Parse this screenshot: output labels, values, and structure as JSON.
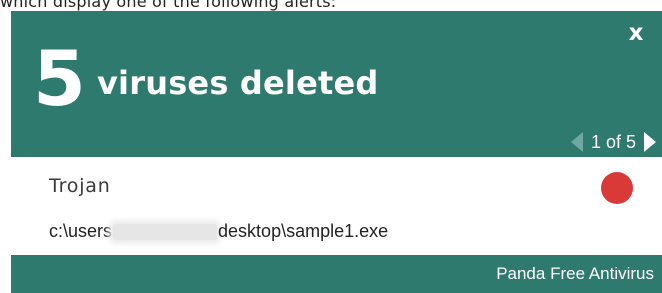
{
  "background_text": "which display one of the following alerts:",
  "notification": {
    "close_label": "x",
    "count": "5",
    "title": "viruses deleted",
    "pager": {
      "current": 1,
      "total": 5,
      "text": "1 of 5"
    },
    "threat": {
      "name": "Trojan",
      "severity_color": "#d93a38",
      "path_prefix": "c:\\users",
      "path_suffix": "desktop\\sample1.exe"
    },
    "brand": "Panda Free Antivirus"
  },
  "colors": {
    "accent": "#2e7a6e",
    "text_on_accent": "#ffffff",
    "severity_red": "#d93a38"
  },
  "icons": {
    "close": "close-icon",
    "prev": "chevron-left-icon",
    "next": "chevron-right-icon",
    "severity": "red-dot-icon"
  }
}
